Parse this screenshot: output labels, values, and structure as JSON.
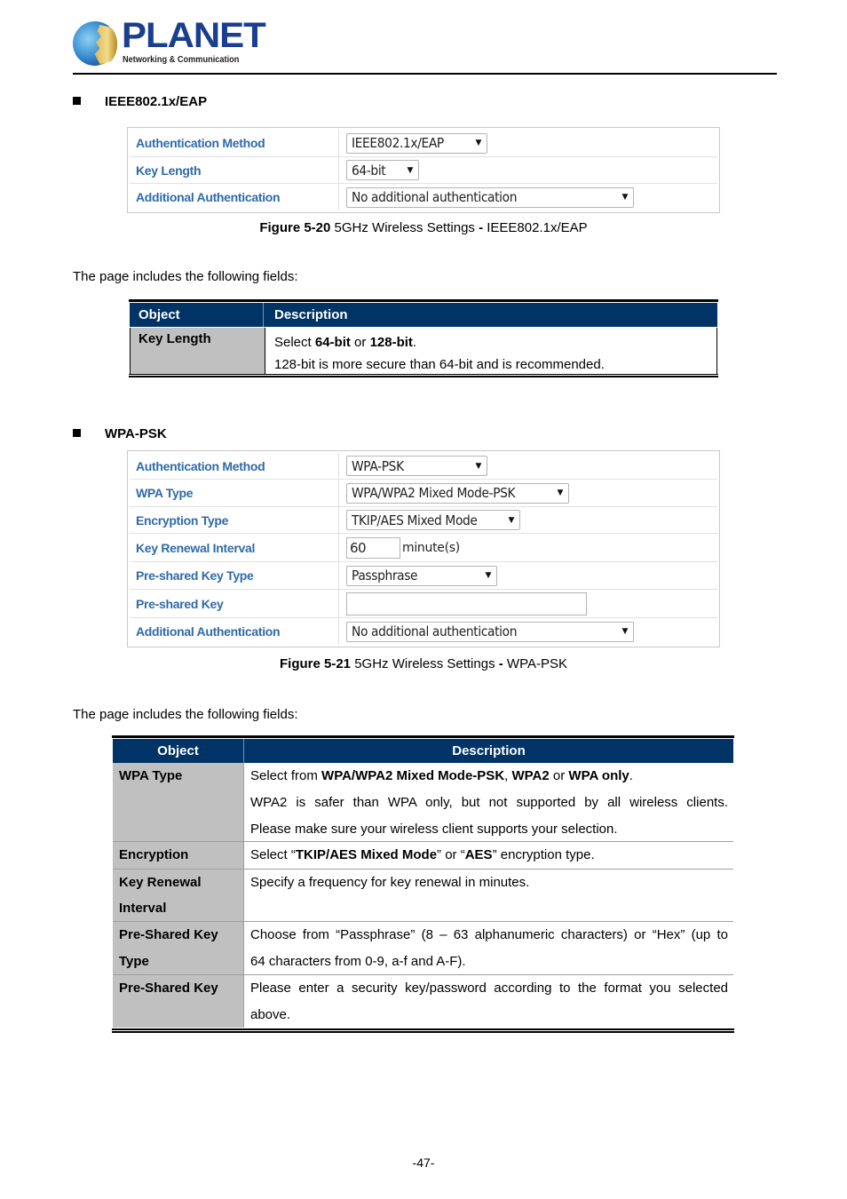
{
  "header": {
    "brand": "PLANET",
    "tagline": "Networking & Communication"
  },
  "sections": {
    "eap": {
      "heading": "IEEE802.1x/EAP",
      "panel": {
        "rows": [
          {
            "label": "Authentication Method",
            "type": "select",
            "value": "IEEE802.1x/EAP"
          },
          {
            "label": "Key Length",
            "type": "select",
            "value": "64-bit"
          },
          {
            "label": "Additional Authentication",
            "type": "select",
            "value": "No additional authentication"
          }
        ]
      },
      "caption_bold": "Figure 5-20",
      "caption_text": " 5GHz Wireless Settings ",
      "caption_dash": "-",
      "caption_tail": " IEEE802.1x/EAP",
      "intro": "The page includes the following fields:",
      "table": {
        "headers": [
          "Object",
          "Description"
        ],
        "rows": [
          {
            "object": "Key Length",
            "line1_prefix": "Select ",
            "line1_b1": "64-bit",
            "line1_mid": " or ",
            "line1_b2": "128-bit",
            "line1_suffix": ".",
            "line2": "128-bit is more secure than 64-bit and is recommended."
          }
        ]
      }
    },
    "wpapsk": {
      "heading": "WPA-PSK",
      "panel": {
        "rows": [
          {
            "label": "Authentication Method",
            "type": "select",
            "value": "WPA-PSK"
          },
          {
            "label": "WPA Type",
            "type": "select",
            "value": "WPA/WPA2 Mixed Mode-PSK"
          },
          {
            "label": "Encryption Type",
            "type": "select",
            "value": "TKIP/AES Mixed Mode"
          },
          {
            "label": "Key Renewal Interval",
            "type": "input",
            "value": "60",
            "unit": "minute(s)"
          },
          {
            "label": "Pre-shared Key Type",
            "type": "select",
            "value": "Passphrase"
          },
          {
            "label": "Pre-shared Key",
            "type": "input",
            "value": ""
          },
          {
            "label": "Additional Authentication",
            "type": "select",
            "value": "No additional authentication"
          }
        ]
      },
      "caption_bold": "Figure 5-21",
      "caption_text": " 5GHz Wireless Settings ",
      "caption_dash": "-",
      "caption_tail": " WPA-PSK",
      "intro": "The page includes the following fields:",
      "table": {
        "headers": [
          "Object",
          "Description"
        ],
        "rows": [
          {
            "object_l1": "WPA Type",
            "d1_prefix": "Select from ",
            "d1_b1": "WPA/WPA2 Mixed Mode-PSK",
            "d1_sep": ", ",
            "d1_b2": "WPA2",
            "d1_mid": " or ",
            "d1_b3": "WPA only",
            "d1_suffix": ".",
            "d2": "WPA2 is safer than WPA only, but not supported by all wireless clients.",
            "d3": "Please make sure your wireless client supports your selection."
          },
          {
            "object_l1": "Encryption",
            "d1_prefix": "Select “",
            "d1_b1": "TKIP/AES Mixed Mode",
            "d1_mid": "” or “",
            "d1_b2": "AES",
            "d1_suffix": "” encryption type."
          },
          {
            "object_l1": "Key Renewal",
            "object_l2": "Interval",
            "d1": "Specify a frequency for key renewal in minutes."
          },
          {
            "object_l1": "Pre-Shared Key",
            "object_l2": "Type",
            "d1": "Choose from “Passphrase” (8 – 63 alphanumeric characters) or “Hex” (up to",
            "d2": "64 characters from 0-9, a-f and A-F)."
          },
          {
            "object_l1": "Pre-Shared Key",
            "d1": "Please enter a security key/password according to the format you selected",
            "d2": "above."
          }
        ]
      }
    }
  },
  "footer": {
    "page_number": "-47-"
  },
  "icons": {
    "dropdown": "▼",
    "bullet": "■"
  }
}
